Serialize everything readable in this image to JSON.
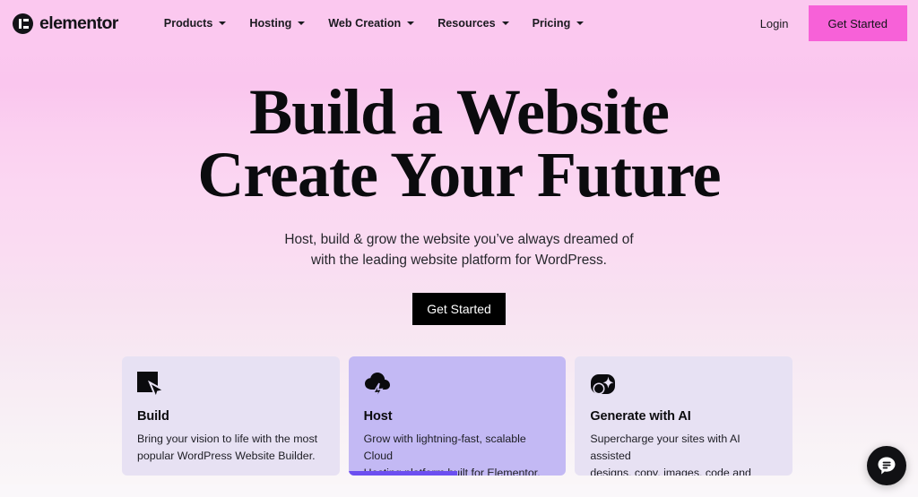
{
  "nav": {
    "brand": "elementor",
    "brand_icon": "elementor-logo-icon",
    "items": [
      {
        "label": "Products",
        "icon": "chevron-down-icon"
      },
      {
        "label": "Hosting",
        "icon": "chevron-down-icon"
      },
      {
        "label": "Web Creation",
        "icon": "chevron-down-icon"
      },
      {
        "label": "Resources",
        "icon": "chevron-down-icon"
      },
      {
        "label": "Pricing",
        "icon": "chevron-down-icon"
      }
    ],
    "login": "Login",
    "cta": "Get Started",
    "cta_color": "#f761d8"
  },
  "hero": {
    "heading_line1": "Build a Website",
    "heading_line2": "Create Your Future",
    "sub_line1": "Host, build & grow the website you’ve always dreamed of",
    "sub_line2": "with the leading website platform for WordPress.",
    "cta": "Get Started",
    "cta_bg": "#000000"
  },
  "cards": [
    {
      "icon": "cursor-square-icon",
      "title": "Build",
      "body_line1": "Bring your vision to life with the most",
      "body_line2": "popular WordPress Website Builder.",
      "bg": "#e7e1f3",
      "active": false
    },
    {
      "icon": "cloud-lightning-icon",
      "title": "Host",
      "body_line1": "Grow with lightning-fast, scalable Cloud",
      "body_line2": "Hosting platform built for Elementor.",
      "bg": "#c3b9f4",
      "active": true,
      "progress_percent": 50,
      "progress_color": "#6c4ff0"
    },
    {
      "icon": "ai-sparkle-icon",
      "title": "Generate with AI",
      "body_line1": "Supercharge your sites with AI assisted",
      "body_line2": "designs, copy, images, code and more.",
      "bg": "#e7e1f3",
      "active": false
    }
  ],
  "chat": {
    "icon": "chat-bubble-icon",
    "bg": "#111114"
  }
}
